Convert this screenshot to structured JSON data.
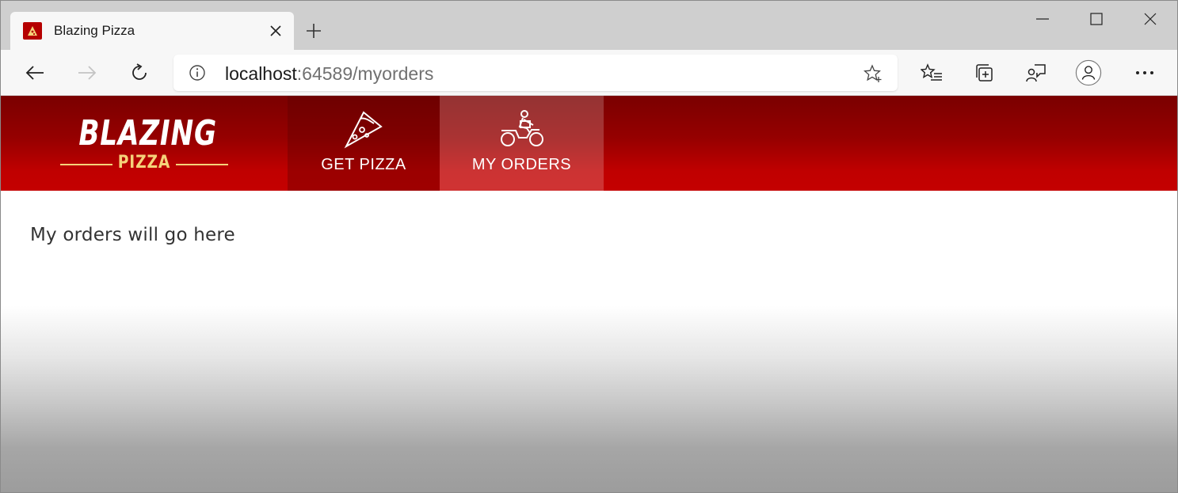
{
  "browser": {
    "tab_title": "Blazing Pizza",
    "url_host": "localhost",
    "url_rest": ":64589/myorders"
  },
  "app": {
    "logo_top": "BLAZING",
    "logo_bottom": "PIZZA",
    "nav": [
      {
        "label": "GET PIZZA",
        "icon": "pizza-slice-icon",
        "active": false
      },
      {
        "label": "MY ORDERS",
        "icon": "motorbike-icon",
        "active": true
      }
    ],
    "content_text": "My orders will go here"
  },
  "colors": {
    "brand_red": "#c00000",
    "logo_gold": "#f5d27a"
  }
}
